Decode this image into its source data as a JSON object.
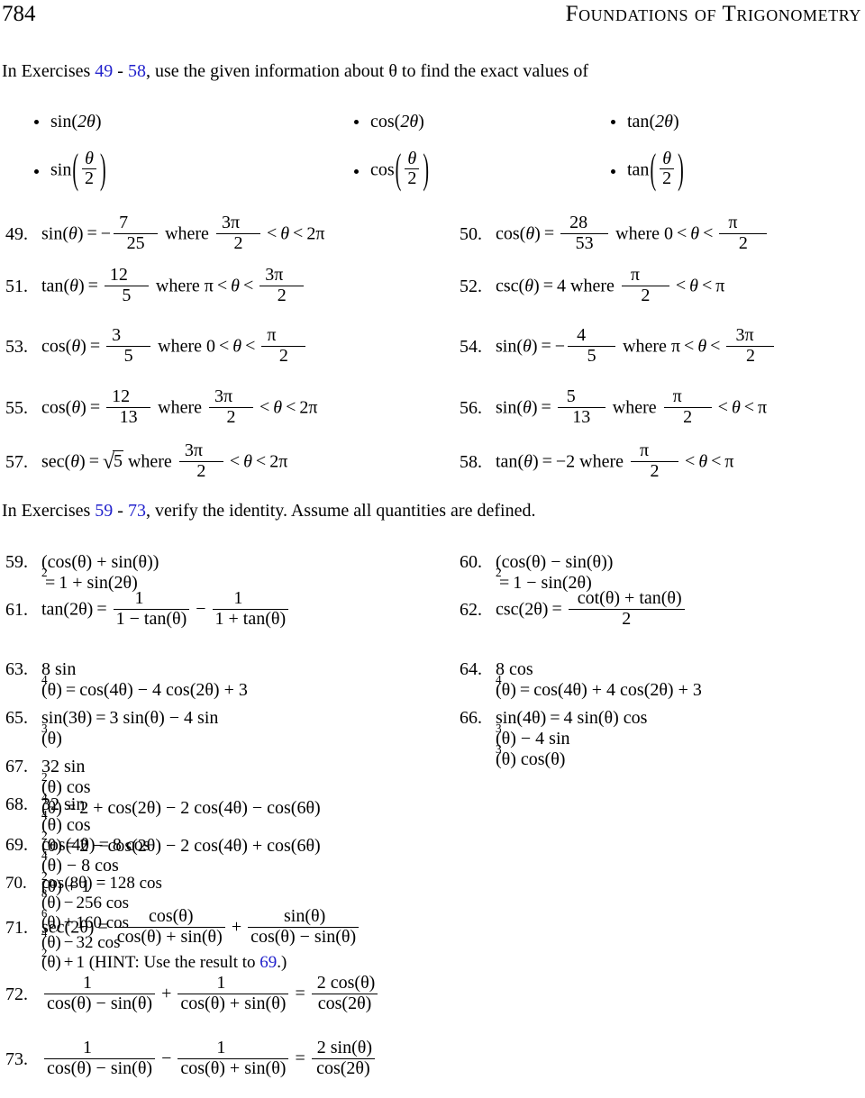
{
  "header": {
    "page_number": "784",
    "book_title": "Foundations of Trigonometry"
  },
  "colors": {
    "link": "#2222cc",
    "text": "#000000",
    "background": "#ffffff"
  },
  "instructions_1": {
    "prefix": "In Exercises",
    "range_start": "49",
    "range_dash": "-",
    "range_end": "58",
    "suffix": ", use the given information about θ to find the exact values of"
  },
  "bullets": [
    {
      "fn": "sin",
      "arg": "2θ",
      "kind": "inline"
    },
    {
      "fn": "cos",
      "arg": "2θ",
      "kind": "inline"
    },
    {
      "fn": "tan",
      "arg": "2θ",
      "kind": "inline"
    },
    {
      "fn": "sin",
      "num": "θ",
      "den": "2",
      "kind": "fraction"
    },
    {
      "fn": "cos",
      "num": "θ",
      "den": "2",
      "kind": "fraction"
    },
    {
      "fn": "tan",
      "num": "θ",
      "den": "2",
      "kind": "fraction"
    }
  ],
  "exercises_49_58": [
    {
      "number": "49.",
      "fn": "sin",
      "arg": "θ",
      "eq": "=",
      "sign": "−",
      "value_num": "7",
      "value_den": "25",
      "where": "where",
      "lo_num": "3π",
      "lo_den": "2",
      "rel1": "<",
      "var": "θ",
      "rel2": "<",
      "hi": "2π"
    },
    {
      "number": "50.",
      "fn": "cos",
      "arg": "θ",
      "eq": "=",
      "sign": "",
      "value_num": "28",
      "value_den": "53",
      "where": "where",
      "lo": "0",
      "rel1": "<",
      "var": "θ",
      "rel2": "<",
      "hi_num": "π",
      "hi_den": "2"
    },
    {
      "number": "51.",
      "fn": "tan",
      "arg": "θ",
      "eq": "=",
      "sign": "",
      "value_num": "12",
      "value_den": "5",
      "where": "where",
      "lo": "π",
      "rel1": "<",
      "var": "θ",
      "rel2": "<",
      "hi_num": "3π",
      "hi_den": "2"
    },
    {
      "number": "52.",
      "fn": "csc",
      "arg": "θ",
      "eq": "=",
      "sign": "",
      "value": "4",
      "where": "where",
      "lo_num": "π",
      "lo_den": "2",
      "rel1": "<",
      "var": "θ",
      "rel2": "<",
      "hi": "π"
    },
    {
      "number": "53.",
      "fn": "cos",
      "arg": "θ",
      "eq": "=",
      "sign": "",
      "value_num": "3",
      "value_den": "5",
      "where": "where",
      "lo": "0",
      "rel1": "<",
      "var": "θ",
      "rel2": "<",
      "hi_num": "π",
      "hi_den": "2"
    },
    {
      "number": "54.",
      "fn": "sin",
      "arg": "θ",
      "eq": "=",
      "sign": "−",
      "value_num": "4",
      "value_den": "5",
      "where": "where",
      "lo": "π",
      "rel1": "<",
      "var": "θ",
      "rel2": "<",
      "hi_num": "3π",
      "hi_den": "2"
    },
    {
      "number": "55.",
      "fn": "cos",
      "arg": "θ",
      "eq": "=",
      "sign": "",
      "value_num": "12",
      "value_den": "13",
      "where": "where",
      "lo_num": "3π",
      "lo_den": "2",
      "rel1": "<",
      "var": "θ",
      "rel2": "<",
      "hi": "2π"
    },
    {
      "number": "56.",
      "fn": "sin",
      "arg": "θ",
      "eq": "=",
      "sign": "",
      "value_num": "5",
      "value_den": "13",
      "where": "where",
      "lo_num": "π",
      "lo_den": "2",
      "rel1": "<",
      "var": "θ",
      "rel2": "<",
      "hi": "π"
    },
    {
      "number": "57.",
      "fn": "sec",
      "arg": "θ",
      "eq": "=",
      "sign": "",
      "sqrt_value": "5",
      "where": "where",
      "lo_num": "3π",
      "lo_den": "2",
      "rel1": "<",
      "var": "θ",
      "rel2": "<",
      "hi": "2π"
    },
    {
      "number": "58.",
      "fn": "tan",
      "arg": "θ",
      "eq": "=",
      "sign": "−",
      "value": "2",
      "where": "where",
      "lo_num": "π",
      "lo_den": "2",
      "rel1": "<",
      "var": "θ",
      "rel2": "<",
      "hi": "π"
    }
  ],
  "instructions_2": {
    "prefix": "In Exercises",
    "range_start": "59",
    "range_dash": "-",
    "range_end": "73",
    "suffix": ", verify the identity. Assume all quantities are defined."
  },
  "identities": {
    "e59": {
      "number": "59.",
      "lhs": "(cos(θ) + sin(θ))",
      "exp": "2",
      "eq": "=",
      "rhs": "1 + sin(2θ)"
    },
    "e60": {
      "number": "60.",
      "lhs": "(cos(θ) − sin(θ))",
      "exp": "2",
      "eq": "=",
      "rhs": "1 − sin(2θ)"
    },
    "e61": {
      "number": "61.",
      "lhs": "tan(2θ)",
      "eq": "=",
      "f1_num": "1",
      "f1_den": "1 − tan(θ)",
      "op": "−",
      "f2_num": "1",
      "f2_den": "1 + tan(θ)"
    },
    "e62": {
      "number": "62.",
      "lhs": "csc(2θ)",
      "eq": "=",
      "f1_num": "cot(θ) + tan(θ)",
      "f1_den": "2"
    },
    "e63": {
      "number": "63.",
      "lhs_coef": "8 sin",
      "lhs_exp": "4",
      "lhs_arg": "(θ)",
      "eq": "=",
      "rhs": "cos(4θ) − 4 cos(2θ) + 3"
    },
    "e64": {
      "number": "64.",
      "lhs_coef": "8 cos",
      "lhs_exp": "4",
      "lhs_arg": "(θ)",
      "eq": "=",
      "rhs": "cos(4θ) + 4 cos(2θ) + 3"
    },
    "e65": {
      "number": "65.",
      "lhs": "sin(3θ)",
      "eq": "=",
      "rhs_a": "3 sin(θ) − 4 sin",
      "rhs_exp": "3",
      "rhs_b": "(θ)"
    },
    "e66": {
      "number": "66.",
      "lhs": "sin(4θ)",
      "eq": "=",
      "rhs_a": "4 sin(θ) cos",
      "rhs_exp1": "3",
      "rhs_b": "(θ) − 4 sin",
      "rhs_exp2": "3",
      "rhs_c": "(θ) cos(θ)"
    },
    "e67": {
      "number": "67.",
      "lhs_a": "32 sin",
      "lhs_exp1": "2",
      "lhs_b": "(θ) cos",
      "lhs_exp2": "4",
      "lhs_c": "(θ)",
      "eq": "=",
      "rhs": "2 + cos(2θ) − 2 cos(4θ) − cos(6θ)"
    },
    "e68": {
      "number": "68.",
      "lhs_a": "32 sin",
      "lhs_exp1": "4",
      "lhs_b": "(θ) cos",
      "lhs_exp2": "2",
      "lhs_c": "(θ)",
      "eq": "=",
      "rhs": "2 − cos(2θ) − 2 cos(4θ) + cos(6θ)"
    },
    "e69": {
      "number": "69.",
      "lhs": "cos(4θ)",
      "eq": "=",
      "rhs_a": "8 cos",
      "rhs_exp1": "4",
      "rhs_b": "(θ) − 8 cos",
      "rhs_exp2": "2",
      "rhs_c": "(θ) + 1"
    },
    "e70": {
      "number": "70.",
      "lhs": "cos(8θ)",
      "eq": "=",
      "t1": "128 cos",
      "t1_exp": "8",
      "t1_arg": "(θ)",
      "o1": "−",
      "t2": "256 cos",
      "t2_exp": "6",
      "t2_arg": "(θ)",
      "o2": "+",
      "t3": "160 cos",
      "t3_exp": "4",
      "t3_arg": "(θ)",
      "o3": "−",
      "t4": "32 cos",
      "t4_exp": "2",
      "t4_arg": "(θ)",
      "o4": "+",
      "t5": "1",
      "hint_open": "(HINT: Use the result to",
      "hint_ref": "69",
      "hint_close": ".)"
    },
    "e71": {
      "number": "71.",
      "lhs": "sec(2θ)",
      "eq": "=",
      "f1_num": "cos(θ)",
      "f1_den": "cos(θ) + sin(θ)",
      "op": "+",
      "f2_num": "sin(θ)",
      "f2_den": "cos(θ) − sin(θ)"
    },
    "e72": {
      "number": "72.",
      "f1_num": "1",
      "f1_den": "cos(θ) − sin(θ)",
      "op": "+",
      "f2_num": "1",
      "f2_den": "cos(θ) + sin(θ)",
      "eq": "=",
      "f3_num": "2 cos(θ)",
      "f3_den": "cos(2θ)"
    },
    "e73": {
      "number": "73.",
      "f1_num": "1",
      "f1_den": "cos(θ) − sin(θ)",
      "op": "−",
      "f2_num": "1",
      "f2_den": "cos(θ) + sin(θ)",
      "eq": "=",
      "f3_num": "2 sin(θ)",
      "f3_den": "cos(2θ)"
    }
  }
}
